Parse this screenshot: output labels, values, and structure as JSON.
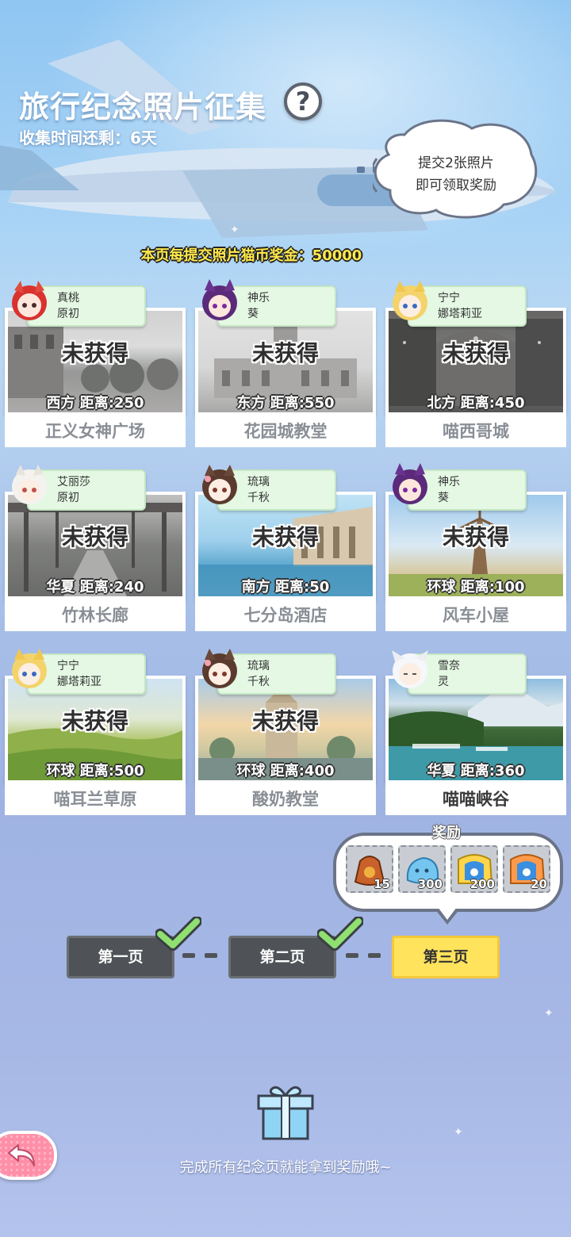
{
  "header": {
    "title": "旅行纪念照片征集",
    "help_icon": "?",
    "timer": "收集时间还剩：6天",
    "bubble_line1": "提交2张照片",
    "bubble_line2": "即可领取奖励",
    "reward_line": "本页每提交照片猫币奖金：50000"
  },
  "cards": [
    {
      "char1": "真桃",
      "char2": "原初",
      "status": "未获得",
      "distance": "西方  距离:250",
      "name": "正义女神广场",
      "obtained": false
    },
    {
      "char1": "神乐",
      "char2": "葵",
      "status": "未获得",
      "distance": "东方  距离:550",
      "name": "花园城教堂",
      "obtained": false
    },
    {
      "char1": "宁宁",
      "char2": "娜塔莉亚",
      "status": "未获得",
      "distance": "北方  距离:450",
      "name": "喵西哥城",
      "obtained": false
    },
    {
      "char1": "艾丽莎",
      "char2": "原初",
      "status": "未获得",
      "distance": "华夏  距离:240",
      "name": "竹林长廊",
      "obtained": false
    },
    {
      "char1": "琉璃",
      "char2": "千秋",
      "status": "未获得",
      "distance": "南方  距离:50",
      "name": "七分岛酒店",
      "obtained": false
    },
    {
      "char1": "神乐",
      "char2": "葵",
      "status": "未获得",
      "distance": "环球  距离:100",
      "name": "风车小屋",
      "obtained": false
    },
    {
      "char1": "宁宁",
      "char2": "娜塔莉亚",
      "status": "未获得",
      "distance": "环球  距离:500",
      "name": "喵耳兰草原",
      "obtained": false
    },
    {
      "char1": "琉璃",
      "char2": "千秋",
      "status": "未获得",
      "distance": "环球  距离:400",
      "name": "酸奶教堂",
      "obtained": false
    },
    {
      "char1": "雪奈",
      "char2": "灵",
      "status": "",
      "distance": "华夏  距离:360",
      "name": "喵喵峡谷",
      "obtained": true
    }
  ],
  "rewards": {
    "title": "奖励",
    "items": [
      {
        "icon": "coin-bag-icon",
        "count": "15"
      },
      {
        "icon": "blue-slime-icon",
        "count": "300"
      },
      {
        "icon": "gold-ticket-icon",
        "count": "200"
      },
      {
        "icon": "orange-ticket-icon",
        "count": "20"
      }
    ]
  },
  "pages": {
    "page1": "第一页",
    "page2": "第二页",
    "page3": "第三页"
  },
  "footer": {
    "text": "完成所有纪念页就能拿到奖励哦~"
  },
  "colors": {
    "accent_yellow": "#ffe35c",
    "tag_green": "#e4f8e4",
    "back_pink": "#ff8fa8"
  }
}
